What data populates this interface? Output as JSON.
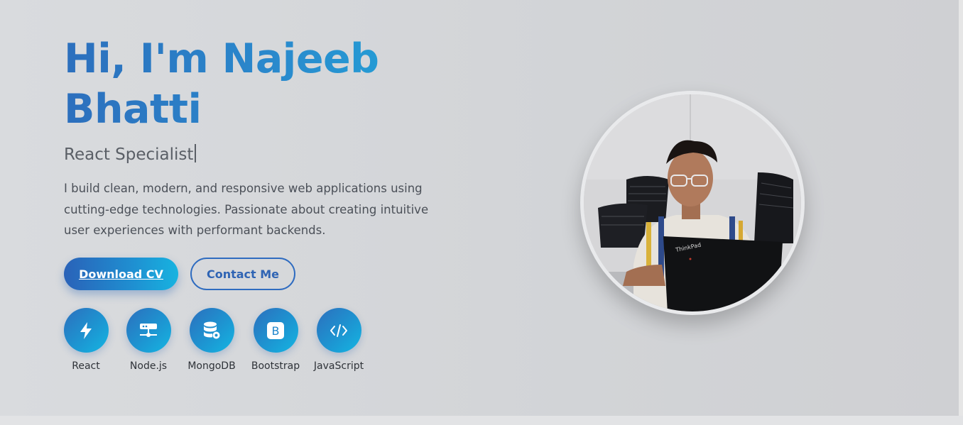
{
  "hero": {
    "title_line1": "Hi, I'm Najeeb",
    "title_line2": "Bhatti",
    "role": "React Specialist",
    "bio": "I build clean, modern, and responsive web applications using cutting-edge technologies. Passionate about creating intuitive user experiences with performant backends."
  },
  "actions": {
    "download_cv": "Download CV",
    "contact_me": "Contact Me"
  },
  "skills": [
    {
      "label": "React",
      "icon": "lightning-icon"
    },
    {
      "label": "Node.js",
      "icon": "server-icon"
    },
    {
      "label": "MongoDB",
      "icon": "database-gear-icon"
    },
    {
      "label": "Bootstrap",
      "icon": "bootstrap-icon"
    },
    {
      "label": "JavaScript",
      "icon": "code-icon"
    }
  ],
  "profile_photo": {
    "laptop_brand": "ThinkPad"
  },
  "colors": {
    "accent_start": "#2c6fbd",
    "accent_end": "#17b3e0",
    "background": "#d6d8db"
  }
}
